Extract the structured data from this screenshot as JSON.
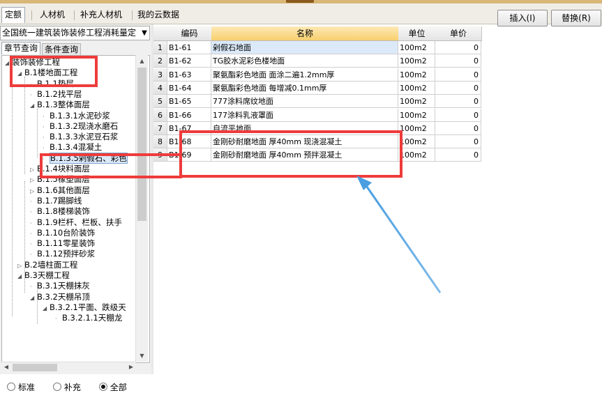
{
  "title_bar": {
    "color": "#d9b779"
  },
  "top_tabs": [
    {
      "label": "定额",
      "active": true
    },
    {
      "label": "人材机",
      "active": false
    },
    {
      "label": "补充人材机",
      "active": false
    },
    {
      "label": "我的云数据",
      "active": false
    }
  ],
  "toolbar": {
    "insert_label": "插入(I)",
    "replace_label": "替换(R)"
  },
  "library_combo": {
    "value": "全国统一建筑装饰装修工程消耗量定",
    "icon": "chevron-down-icon"
  },
  "sub_tabs": [
    {
      "label": "章节查询",
      "active": true
    },
    {
      "label": "条件查询",
      "active": false
    }
  ],
  "tree": [
    {
      "label": "装饰装修工程",
      "state": "open"
    },
    {
      "label": "B.1楼地面工程",
      "state": "open"
    },
    {
      "label": "B.1.1垫层",
      "state": "leaf"
    },
    {
      "label": "B.1.2找平层",
      "state": "leaf"
    },
    {
      "label": "B.1.3整体面层",
      "state": "open"
    },
    {
      "label": "B.1.3.1水泥砂浆",
      "state": "leaf"
    },
    {
      "label": "B.1.3.2现浇水磨石",
      "state": "leaf"
    },
    {
      "label": "B.1.3.3水泥豆石浆",
      "state": "leaf"
    },
    {
      "label": "B.1.3.4混凝土",
      "state": "leaf"
    },
    {
      "label": "B.1.3.5剁假石、彩色",
      "state": "leaf",
      "selected": true
    },
    {
      "label": "B.1.4块料面层",
      "state": "closed"
    },
    {
      "label": "B.1.5橡塑面层",
      "state": "closed"
    },
    {
      "label": "B.1.6其他面层",
      "state": "closed"
    },
    {
      "label": "B.1.7踢脚线",
      "state": "leaf"
    },
    {
      "label": "B.1.8楼梯装饰",
      "state": "leaf"
    },
    {
      "label": "B.1.9栏杆、栏板、扶手",
      "state": "leaf"
    },
    {
      "label": "B.1.10台阶装饰",
      "state": "leaf"
    },
    {
      "label": "B.1.11零星装饰",
      "state": "leaf"
    },
    {
      "label": "B.1.12预拌砂浆",
      "state": "leaf"
    },
    {
      "label": "B.2墙柱面工程",
      "state": "closed"
    },
    {
      "label": "B.3天棚工程",
      "state": "open"
    },
    {
      "label": "B.3.1天棚抹灰",
      "state": "leaf"
    },
    {
      "label": "B.3.2天棚吊顶",
      "state": "open"
    },
    {
      "label": "B.3.2.1平面、跌级天",
      "state": "open"
    },
    {
      "label": "B.3.2.1.1天棚龙",
      "state": "leaf"
    }
  ],
  "filter_radios": [
    {
      "label": "标准",
      "checked": false
    },
    {
      "label": "补充",
      "checked": false
    },
    {
      "label": "全部",
      "checked": true
    }
  ],
  "table": {
    "columns": [
      "编码",
      "名称",
      "单位",
      "单价"
    ],
    "rows": [
      {
        "no": "1",
        "code": "B1-61",
        "name": "剁假石地面",
        "unit": "100m2",
        "price": "0",
        "selected": true
      },
      {
        "no": "2",
        "code": "B1-62",
        "name": "TG胶水泥彩色楼地面",
        "unit": "100m2",
        "price": "0"
      },
      {
        "no": "3",
        "code": "B1-63",
        "name": "聚氨酯彩色地面 面涂二遍1.2mm厚",
        "unit": "100m2",
        "price": "0"
      },
      {
        "no": "4",
        "code": "B1-64",
        "name": "聚氨酯彩色地面 每增减0.1mm厚",
        "unit": "100m2",
        "price": "0"
      },
      {
        "no": "5",
        "code": "B1-65",
        "name": "777涂料席纹地面",
        "unit": "100m2",
        "price": "0"
      },
      {
        "no": "6",
        "code": "B1-66",
        "name": "177涂料乳液罩面",
        "unit": "100m2",
        "price": "0"
      },
      {
        "no": "7",
        "code": "B1-67",
        "name": "自流平地面",
        "unit": "100m2",
        "price": "0"
      },
      {
        "no": "8",
        "code": "B1-68",
        "name": "金刚砂耐磨地面 厚40mm 现浇混凝土",
        "unit": "100m2",
        "price": "0"
      },
      {
        "no": "9",
        "code": "B1-69",
        "name": "金刚砂耐磨地面 厚40mm 预拌混凝土",
        "unit": "100m2",
        "price": "0"
      }
    ]
  },
  "annotation": {
    "highlight_color": "#ee3b3b",
    "arrow_color": "#4a9ee0"
  }
}
